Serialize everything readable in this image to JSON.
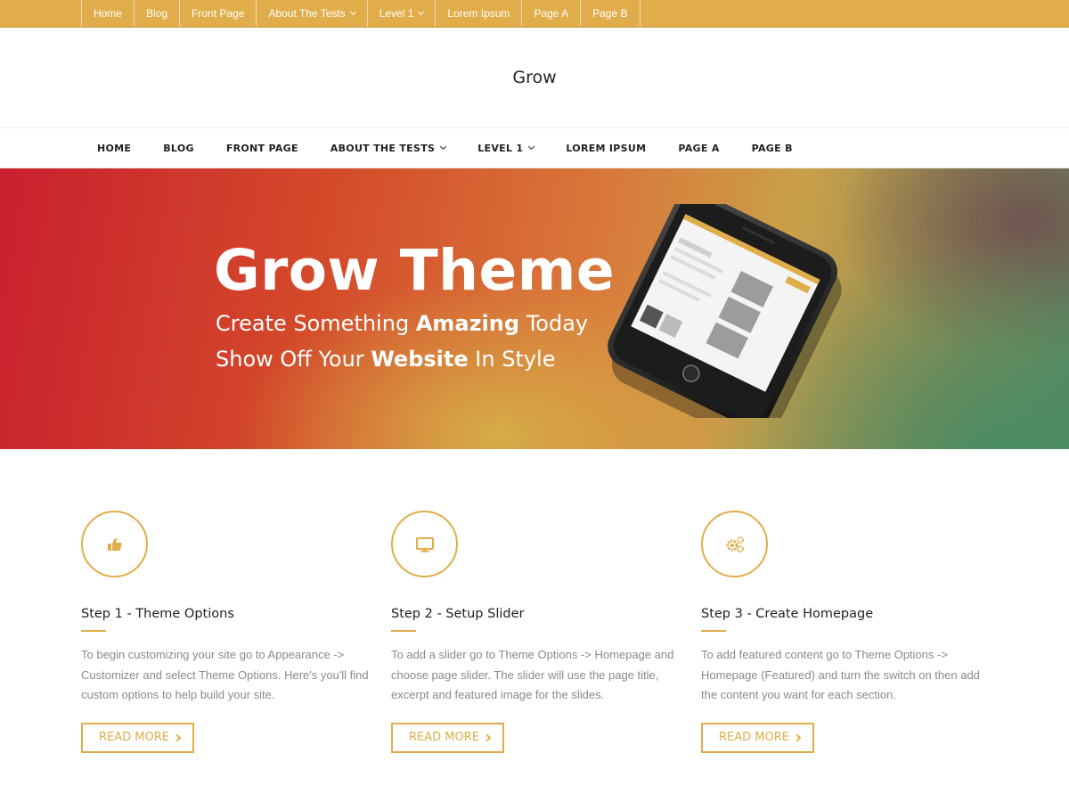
{
  "topbar": {
    "items": [
      {
        "label": "Home"
      },
      {
        "label": "Blog"
      },
      {
        "label": "Front Page"
      },
      {
        "label": "About The Tests"
      },
      {
        "label": "Level 1"
      },
      {
        "label": "Lorem Ipsum"
      },
      {
        "label": "Page A"
      },
      {
        "label": "Page B"
      }
    ]
  },
  "site": {
    "title": "Grow"
  },
  "mainnav": {
    "items": [
      {
        "label": "HOME"
      },
      {
        "label": "BLOG"
      },
      {
        "label": "FRONT PAGE"
      },
      {
        "label": "ABOUT THE TESTS"
      },
      {
        "label": "LEVEL 1"
      },
      {
        "label": "LOREM IPSUM"
      },
      {
        "label": "PAGE A"
      },
      {
        "label": "PAGE B"
      }
    ]
  },
  "hero": {
    "title": "Grow Theme",
    "line1": {
      "pre": "Create Something ",
      "bold": "Amazing",
      "post": " Today"
    },
    "line2": {
      "pre": "Show Off Your ",
      "bold": "Website",
      "post": " In Style"
    }
  },
  "features": [
    {
      "icon": "thumbs-up-icon",
      "title": "Step 1 - Theme Options",
      "text": "To begin customizing your site go to Appearance -> Customizer and select Theme Options. Here's you'll find custom options to help build your site.",
      "button": "READ MORE"
    },
    {
      "icon": "desktop-icon",
      "title": "Step 2 - Setup Slider",
      "text": "To add a slider go to Theme Options -> Homepage and choose page slider. The slider will use the page title, excerpt and featured image for the slides.",
      "button": "READ MORE"
    },
    {
      "icon": "gears-icon",
      "title": "Step 3 - Create Homepage",
      "text": "To add featured content go to Theme Options -> Homepage (Featured) and turn the switch on then add the content you want for each section.",
      "button": "READ MORE"
    }
  ],
  "colors": {
    "accent": "#e0ad4a",
    "text": "#222222",
    "muted": "#8a8a8a"
  }
}
